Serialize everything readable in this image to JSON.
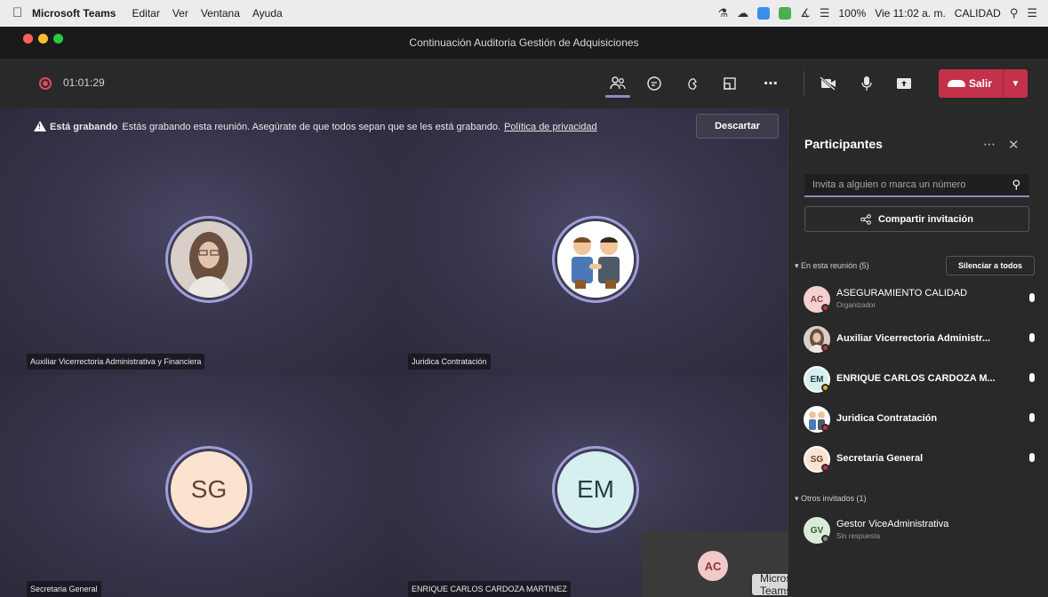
{
  "menubar": {
    "app_name": "Microsoft Teams",
    "items": [
      "Editar",
      "Ver",
      "Ventana",
      "Ayuda"
    ],
    "battery": "100%",
    "clock": "Vie 11:02 a. m.",
    "user": "CALIDAD"
  },
  "window": {
    "title": "Continuación Auditoria Gestión de Adquisiciones"
  },
  "toolbar": {
    "elapsed": "01:01:29",
    "leave_label": "Salir",
    "icons": [
      "people-icon",
      "chat-icon",
      "reactions-icon",
      "rooms-icon",
      "more-icon",
      "camera-off-icon",
      "mic-icon",
      "share-screen-icon"
    ],
    "leave_color": "#c4314b",
    "accent": "#8b8cc7"
  },
  "banner": {
    "title": "Está grabando",
    "message": "Estás grabando esta reunión. Asegúrate de que todos sepan que se les está grabando.",
    "link": "Política de privacidad",
    "dismiss_label": "Descartar"
  },
  "tiles": [
    {
      "name": "Auxiliar Vicerrectoria Administrativa y Financiera",
      "kind": "photo"
    },
    {
      "name": "Juridica Contratación",
      "kind": "illustration"
    },
    {
      "name": "Secretaria General",
      "initials": "SG",
      "bg": "#fbe3cf"
    },
    {
      "name": "ENRIQUE CARLOS CARDOZA MARTINEZ",
      "initials": "EM",
      "bg": "#d6efef"
    }
  ],
  "self_view": {
    "initials": "AC"
  },
  "tooltip": "Microsoft Teams",
  "panel": {
    "title": "Participantes",
    "invite_placeholder": "Invita a alguien o marca un número",
    "share_label": "Compartir invitación",
    "in_meeting_label": "En esta reunión (5)",
    "mute_all_label": "Silenciar a todos",
    "participants": [
      {
        "name": "ASEGURAMIENTO CALIDAD",
        "role": "Organizador",
        "initials": "AC",
        "bg": "#f5d0d0",
        "status": "#c4314b"
      },
      {
        "name": "Auxiliar Vicerrectoria Administr...",
        "role": "",
        "initials": "",
        "bg": "#b9a89a",
        "status": "#c4314b"
      },
      {
        "name": "ENRIQUE CARLOS CARDOZA M...",
        "role": "",
        "initials": "EM",
        "bg": "#d6efef",
        "status": "#f0a830"
      },
      {
        "name": "Juridica Contratación",
        "role": "",
        "initials": "",
        "bg": "#dcdcdc",
        "status": "#c4314b"
      },
      {
        "name": "Secretaria General",
        "role": "",
        "initials": "SG",
        "bg": "#fbe3cf",
        "status": "#c4314b"
      }
    ],
    "others_label": "Otros invitados (1)",
    "others": [
      {
        "name": "Gestor ViceAdministrativa",
        "role": "Sin respuesta",
        "initials": "GV",
        "bg": "#d9ecd9"
      }
    ]
  }
}
